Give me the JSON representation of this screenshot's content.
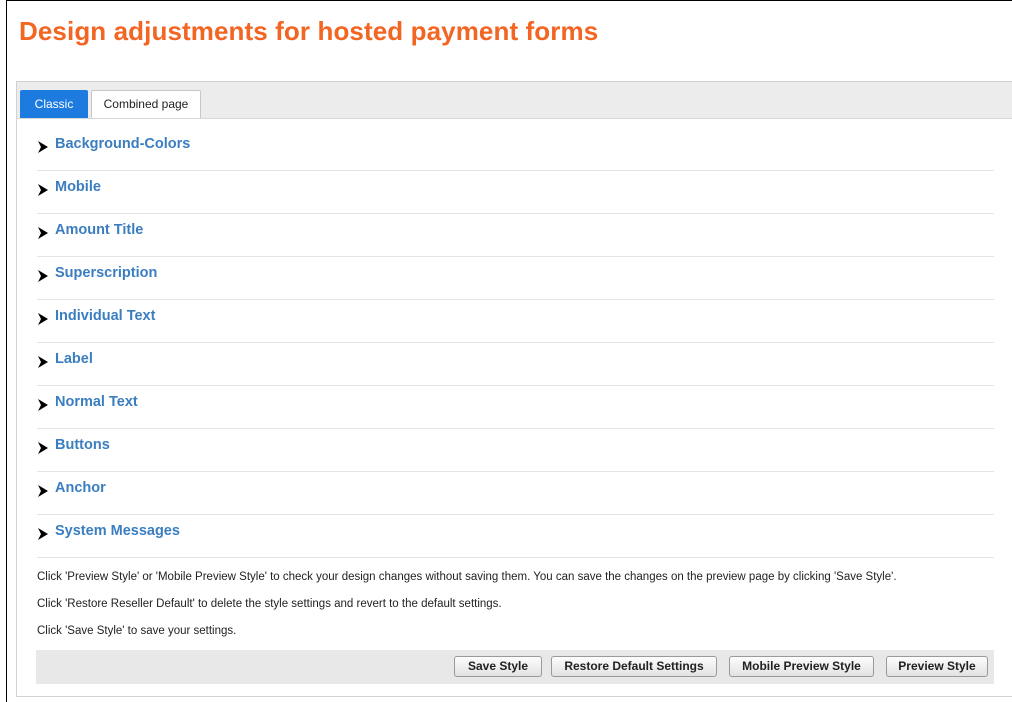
{
  "page": {
    "title": "Design adjustments for hosted payment forms",
    "accent_color": "#f26522",
    "link_color": "#3a7ec0",
    "active_tab_color": "#1d7be0"
  },
  "tabs": [
    {
      "label": "Classic",
      "active": true
    },
    {
      "label": "Combined page",
      "active": false
    }
  ],
  "sections": [
    {
      "label": "Background-Colors",
      "icon": "collapsed-triangle-icon"
    },
    {
      "label": "Mobile",
      "icon": "collapsed-triangle-icon"
    },
    {
      "label": "Amount Title",
      "icon": "collapsed-triangle-icon"
    },
    {
      "label": "Superscription",
      "icon": "collapsed-triangle-icon"
    },
    {
      "label": "Individual Text",
      "icon": "collapsed-triangle-icon"
    },
    {
      "label": "Label",
      "icon": "collapsed-triangle-icon"
    },
    {
      "label": "Normal Text",
      "icon": "collapsed-triangle-icon"
    },
    {
      "label": "Buttons",
      "icon": "collapsed-triangle-icon"
    },
    {
      "label": "Anchor",
      "icon": "collapsed-triangle-icon"
    },
    {
      "label": "System Messages",
      "icon": "collapsed-triangle-icon"
    }
  ],
  "info_lines": [
    "Click 'Preview Style' or 'Mobile Preview Style' to check your design changes without saving them. You can save the changes on the preview page by clicking 'Save Style'.",
    "Click 'Restore Reseller Default' to delete the style settings and revert to the default settings.",
    "Click 'Save Style' to save your settings."
  ],
  "buttons": {
    "save": "Save Style",
    "restore": "Restore Default Settings",
    "mobile_preview": "Mobile Preview Style",
    "preview": "Preview Style"
  }
}
